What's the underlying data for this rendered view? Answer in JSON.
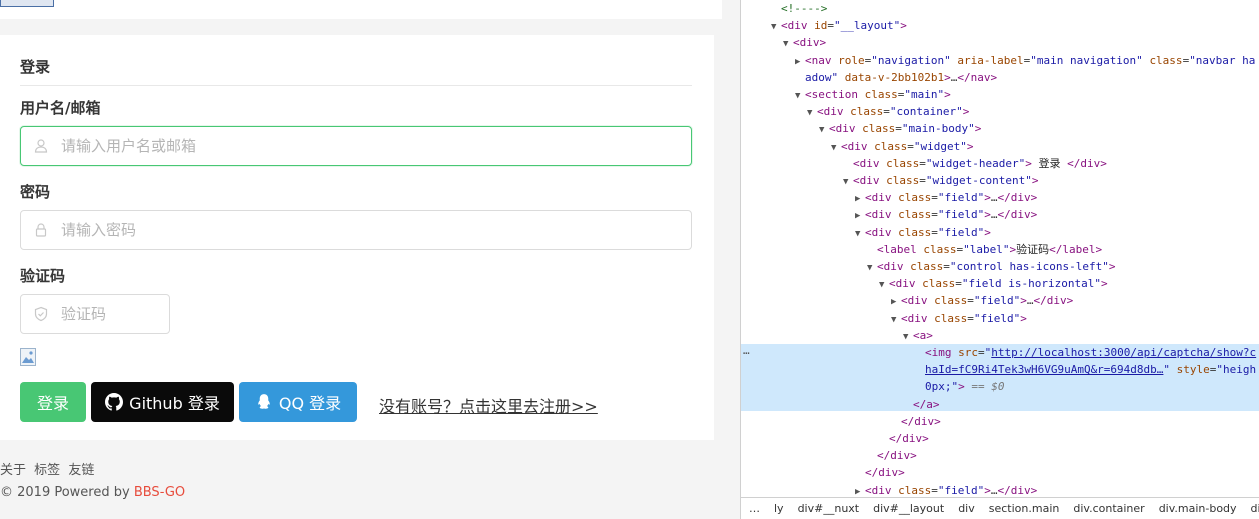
{
  "widget": {
    "header": "登录",
    "username_label": "用户名/邮箱",
    "username_placeholder": "请输入用户名或邮箱",
    "password_label": "密码",
    "password_placeholder": "请输入密码",
    "captcha_label": "验证码",
    "captcha_placeholder": "验证码",
    "login_btn": "登录",
    "github_btn": "Github 登录",
    "qq_btn": "QQ 登录",
    "register_link": "没有账号？点击这里去注册>>"
  },
  "footer": {
    "links": [
      "关于",
      "标签",
      "友链"
    ],
    "copyright": "© 2019 Powered by ",
    "brand": "BBS-GO"
  },
  "devtools": {
    "lines": [
      {
        "indent": 0,
        "tri": "",
        "html": "<span class='cmt'>&lt;!----&gt;</span>"
      },
      {
        "indent": 0,
        "tri": "▼",
        "html": "<span class='tag'>&lt;div</span> <span class='attr'>id</span>=<span class='val'>\"__layout\"</span><span class='tag'>&gt;</span>"
      },
      {
        "indent": 1,
        "tri": "▼",
        "html": "<span class='tag'>&lt;div&gt;</span>"
      },
      {
        "indent": 2,
        "tri": "▶",
        "html": "<span class='tag'>&lt;nav</span> <span class='attr'>role</span>=<span class='val'>\"navigation\"</span> <span class='attr'>aria-label</span>=<span class='val'>\"main navigation\"</span> <span class='attr'>class</span>=<span class='val'>\"navbar ha</span>"
      },
      {
        "indent": 2,
        "tri": "",
        "html": "<span class='val'>adow\"</span> <span class='attr'>data-v-2bb102b1</span><span class='tag'>&gt;</span>…<span class='tag'>&lt;/nav&gt;</span>"
      },
      {
        "indent": 2,
        "tri": "▼",
        "html": "<span class='tag'>&lt;section</span> <span class='attr'>class</span>=<span class='val'>\"main\"</span><span class='tag'>&gt;</span>"
      },
      {
        "indent": 3,
        "tri": "▼",
        "html": "<span class='tag'>&lt;div</span> <span class='attr'>class</span>=<span class='val'>\"container\"</span><span class='tag'>&gt;</span>"
      },
      {
        "indent": 4,
        "tri": "▼",
        "html": "<span class='tag'>&lt;div</span> <span class='attr'>class</span>=<span class='val'>\"main-body\"</span><span class='tag'>&gt;</span>"
      },
      {
        "indent": 5,
        "tri": "▼",
        "html": "<span class='tag'>&lt;div</span> <span class='attr'>class</span>=<span class='val'>\"widget\"</span><span class='tag'>&gt;</span>"
      },
      {
        "indent": 6,
        "tri": "",
        "html": "<span class='tag'>&lt;div</span> <span class='attr'>class</span>=<span class='val'>\"widget-header\"</span><span class='tag'>&gt;</span><span class='txt'> 登录 </span><span class='tag'>&lt;/div&gt;</span>"
      },
      {
        "indent": 6,
        "tri": "▼",
        "html": "<span class='tag'>&lt;div</span> <span class='attr'>class</span>=<span class='val'>\"widget-content\"</span><span class='tag'>&gt;</span>"
      },
      {
        "indent": 7,
        "tri": "▶",
        "html": "<span class='tag'>&lt;div</span> <span class='attr'>class</span>=<span class='val'>\"field\"</span><span class='tag'>&gt;</span>…<span class='tag'>&lt;/div&gt;</span>"
      },
      {
        "indent": 7,
        "tri": "▶",
        "html": "<span class='tag'>&lt;div</span> <span class='attr'>class</span>=<span class='val'>\"field\"</span><span class='tag'>&gt;</span>…<span class='tag'>&lt;/div&gt;</span>"
      },
      {
        "indent": 7,
        "tri": "▼",
        "html": "<span class='tag'>&lt;div</span> <span class='attr'>class</span>=<span class='val'>\"field\"</span><span class='tag'>&gt;</span>"
      },
      {
        "indent": 8,
        "tri": "",
        "html": "<span class='tag'>&lt;label</span> <span class='attr'>class</span>=<span class='val'>\"label\"</span><span class='tag'>&gt;</span><span class='txt'>验证码</span><span class='tag'>&lt;/label&gt;</span>"
      },
      {
        "indent": 8,
        "tri": "▼",
        "html": "<span class='tag'>&lt;div</span> <span class='attr'>class</span>=<span class='val'>\"control has-icons-left\"</span><span class='tag'>&gt;</span>"
      },
      {
        "indent": 9,
        "tri": "▼",
        "html": "<span class='tag'>&lt;div</span> <span class='attr'>class</span>=<span class='val'>\"field is-horizontal\"</span><span class='tag'>&gt;</span>"
      },
      {
        "indent": 10,
        "tri": "▶",
        "html": "<span class='tag'>&lt;div</span> <span class='attr'>class</span>=<span class='val'>\"field\"</span><span class='tag'>&gt;</span>…<span class='tag'>&lt;/div&gt;</span>"
      },
      {
        "indent": 10,
        "tri": "▼",
        "html": "<span class='tag'>&lt;div</span> <span class='attr'>class</span>=<span class='val'>\"field\"</span><span class='tag'>&gt;</span>"
      },
      {
        "indent": 11,
        "tri": "▼",
        "html": "<span class='tag'>&lt;a&gt;</span>"
      },
      {
        "indent": 12,
        "tri": "",
        "html": "<span class='tag'>&lt;img</span> <span class='attr'>src</span>=<span class='val'>\"</span><span class='link'>http://localhost:3000/api/captcha/show?c</span>"
      },
      {
        "indent": 12,
        "tri": "",
        "html": "<span class='link'>haId=fC9Ri4Tek3wH6VG9uAmQ&amp;r=694d8db…</span><span class='val'>\"</span> <span class='attr'>style</span>=<span class='val'>\"heigh</span>"
      },
      {
        "indent": 12,
        "tri": "",
        "html": "<span class='val'>0px;\"</span><span class='tag'>&gt;</span> <span style='color:#777'>== <i>$0</i></span>"
      },
      {
        "indent": 11,
        "tri": "",
        "html": "<span class='tag'>&lt;/a&gt;</span>"
      },
      {
        "indent": 10,
        "tri": "",
        "html": "<span class='tag'>&lt;/div&gt;</span>"
      },
      {
        "indent": 9,
        "tri": "",
        "html": "<span class='tag'>&lt;/div&gt;</span>"
      },
      {
        "indent": 8,
        "tri": "",
        "html": "<span class='tag'>&lt;/div&gt;</span>"
      },
      {
        "indent": 7,
        "tri": "",
        "html": "<span class='tag'>&lt;/div&gt;</span>"
      },
      {
        "indent": 7,
        "tri": "▶",
        "html": "<span class='tag'>&lt;div</span> <span class='attr'>class</span>=<span class='val'>\"field\"</span><span class='tag'>&gt;</span>…<span class='tag'>&lt;/div&gt;</span>"
      }
    ],
    "dots": "…",
    "breadcrumbs": [
      "ly",
      "div#__nuxt",
      "div#__layout",
      "div",
      "section.main",
      "div.container",
      "div.main-body",
      "div.wid"
    ]
  }
}
